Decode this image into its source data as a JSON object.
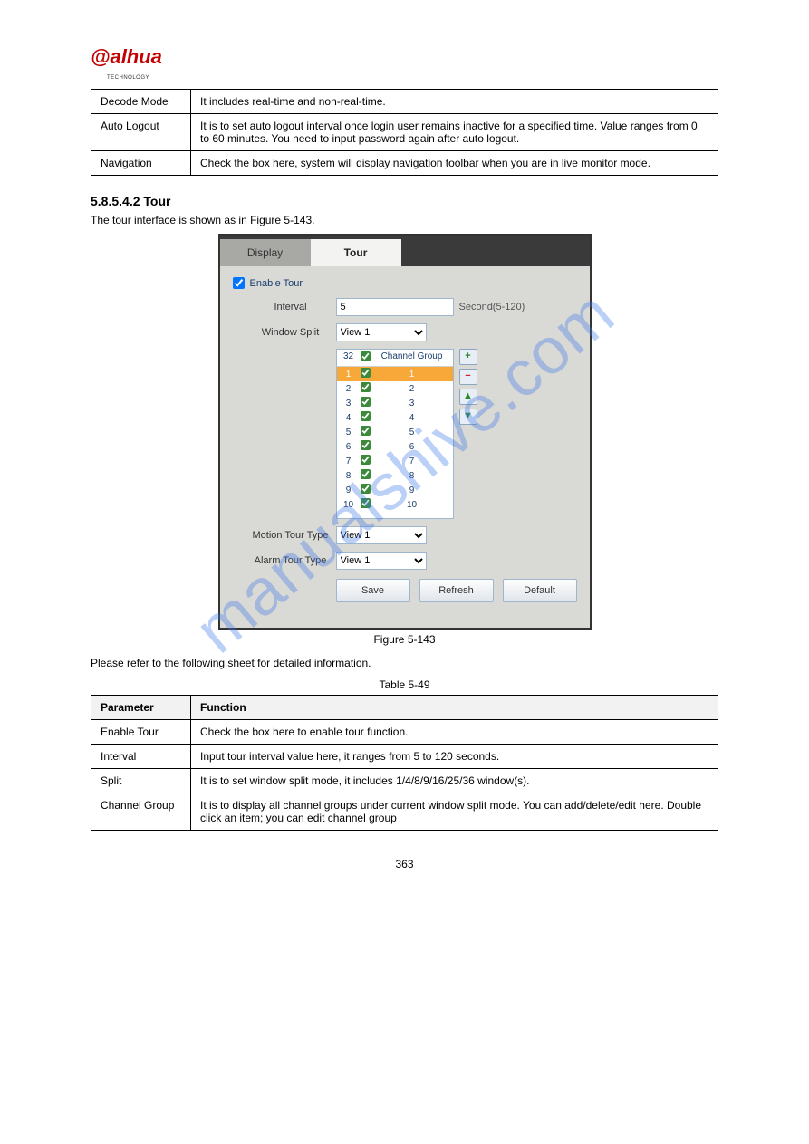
{
  "logo": {
    "text": "alhua",
    "sub": "TECHNOLOGY"
  },
  "watermark": "manualshive.com",
  "table1": {
    "rows": [
      {
        "param": "Decode Mode",
        "desc": "It includes real-time and non-real-time."
      },
      {
        "param": "Auto Logout",
        "desc": "It is to set auto logout interval once login user remains inactive for a specified time. Value ranges from 0 to 60 minutes. You need to input password again after auto logout."
      },
      {
        "param": "Navigation",
        "desc": "Check the box here, system will display navigation toolbar when you are in live monitor mode."
      }
    ]
  },
  "section": {
    "heading": "5.8.5.4.2 Tour",
    "intro": "The tour interface is shown as in Figure 5-143."
  },
  "figure": {
    "tabs": {
      "display": "Display",
      "tour": "Tour"
    },
    "enable": {
      "label": "Enable Tour",
      "checked": true
    },
    "interval": {
      "label": "Interval",
      "value": "5",
      "hint": "Second(5-120)"
    },
    "windowSplit": {
      "label": "Window Split",
      "value": "View 1"
    },
    "channelGroup": {
      "count": "32",
      "headerLabel": "Channel Group",
      "rows": [
        {
          "idx": "1",
          "checked": true,
          "group": "1",
          "selected": true
        },
        {
          "idx": "2",
          "checked": true,
          "group": "2",
          "selected": false
        },
        {
          "idx": "3",
          "checked": true,
          "group": "3",
          "selected": false
        },
        {
          "idx": "4",
          "checked": true,
          "group": "4",
          "selected": false
        },
        {
          "idx": "5",
          "checked": true,
          "group": "5",
          "selected": false
        },
        {
          "idx": "6",
          "checked": true,
          "group": "6",
          "selected": false
        },
        {
          "idx": "7",
          "checked": true,
          "group": "7",
          "selected": false
        },
        {
          "idx": "8",
          "checked": true,
          "group": "8",
          "selected": false
        },
        {
          "idx": "9",
          "checked": true,
          "group": "9",
          "selected": false
        },
        {
          "idx": "10",
          "checked": true,
          "group": "10",
          "selected": false
        }
      ]
    },
    "motionTour": {
      "label": "Motion Tour Type",
      "value": "View 1"
    },
    "alarmTour": {
      "label": "Alarm Tour Type",
      "value": "View 1"
    },
    "buttons": {
      "save": "Save",
      "refresh": "Refresh",
      "default": "Default"
    },
    "caption": "Figure 5-143"
  },
  "afterFigure": {
    "line1": "Please refer to the following sheet for detailed information.",
    "caption": "Table 5-49"
  },
  "table2": {
    "headerParam": "Parameter",
    "headerFunc": "Function",
    "rows": [
      {
        "param": "Enable Tour",
        "desc": "Check the box here to enable tour function."
      },
      {
        "param": "Interval",
        "desc": "Input tour interval value here, it ranges from 5 to 120 seconds."
      },
      {
        "param": "Split",
        "desc": "It is to set window split mode, it includes 1/4/8/9/16/25/36 window(s)."
      },
      {
        "param": "Channel Group",
        "desc": "It is to display all channel groups under current window split mode. You can add/delete/edit here. Double click an item; you can edit channel group"
      }
    ]
  },
  "pageNumber": "363"
}
